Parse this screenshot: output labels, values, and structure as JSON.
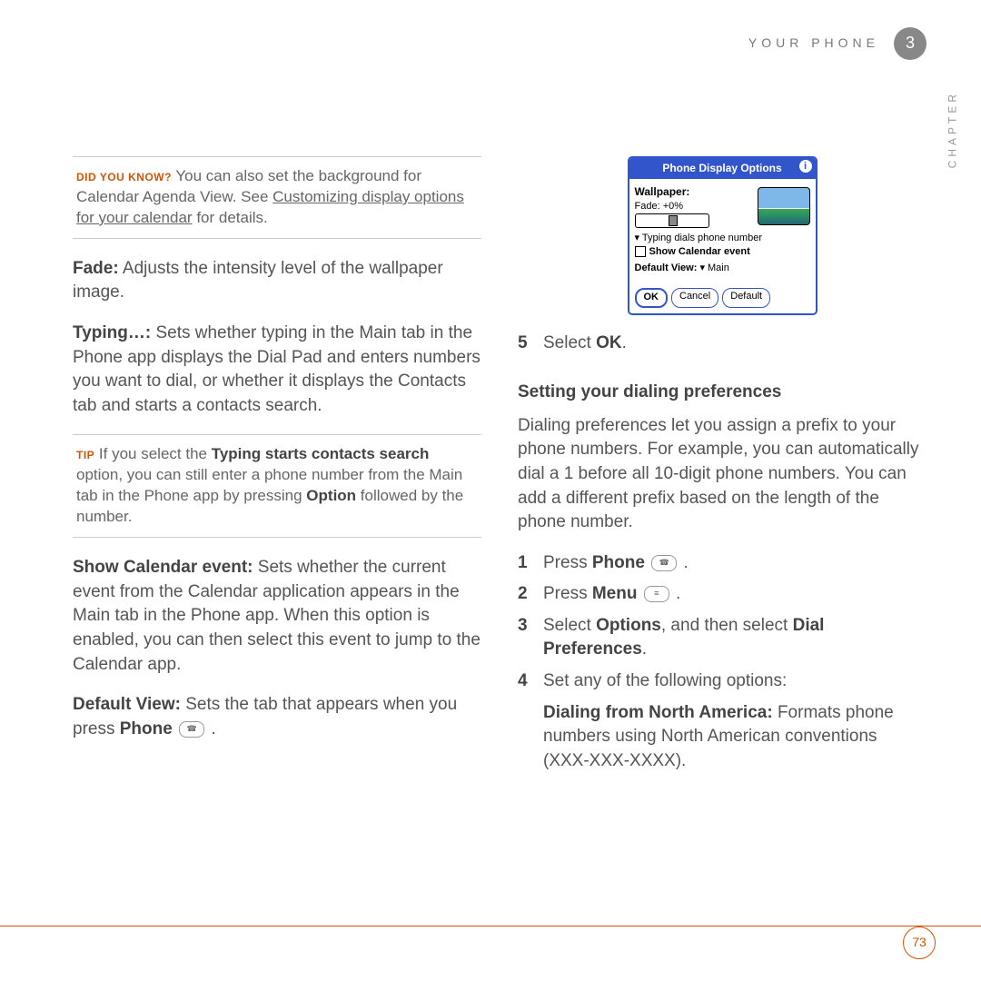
{
  "header": {
    "title": "YOUR PHONE",
    "chapter_num": "3",
    "chapter_label": "CHAPTER"
  },
  "page_number": "73",
  "left": {
    "dyk": {
      "label": "DID YOU KNOW?",
      "lead": "You can also set the background for Calendar Agenda View. See ",
      "link": "Customizing display options for your calendar",
      "trail": " for details."
    },
    "fade_term": "Fade:",
    "fade_desc": " Adjusts the intensity level of the wallpaper image.",
    "typing_term": "Typing…:",
    "typing_desc": " Sets whether typing in the Main tab in the Phone app displays the Dial Pad and enters numbers you want to dial, or whether it displays the Contacts tab and starts a contacts search.",
    "tip": {
      "label": "TIP",
      "t1": "If you select the ",
      "b1": "Typing starts contacts search",
      "t2": " option, you can still enter a phone number from the Main tab in the Phone app by pressing ",
      "b2": "Option",
      "t3": " followed by the number."
    },
    "showcal_term": "Show Calendar event:",
    "showcal_desc": " Sets whether the current event from the Calendar application appears in the Main tab in the Phone app. When this option is enabled, you can then select this event to jump to the Calendar app.",
    "defview_term": "Default View:",
    "defview_t1": " Sets the tab that appears when you press ",
    "defview_b1": "Phone",
    "defview_t2": " ."
  },
  "palm": {
    "title": "Phone Display Options",
    "wall_label": "Wallpaper:",
    "fade_label": "Fade:",
    "fade_value": "+0%",
    "drop": "Typing dials phone number",
    "check": "Show Calendar event",
    "def_label": "Default View:",
    "def_value": "Main",
    "btn_ok": "OK",
    "btn_cancel": "Cancel",
    "btn_default": "Default"
  },
  "right": {
    "step5_num": "5",
    "step5_t1": "Select ",
    "step5_b1": "OK",
    "step5_t2": ".",
    "section": "Setting your dialing preferences",
    "para": "Dialing preferences let you assign a prefix to your phone numbers. For example, you can automatically dial a 1 before all 10-digit phone numbers. You can add a different prefix based on the length of the phone number.",
    "s1_num": "1",
    "s1_t1": "Press ",
    "s1_b1": "Phone",
    "s1_t2": " .",
    "s2_num": "2",
    "s2_t1": "Press ",
    "s2_b1": "Menu",
    "s2_t2": " .",
    "s3_num": "3",
    "s3_t1": "Select ",
    "s3_b1": "Options",
    "s3_t2": ", and then select ",
    "s3_b2": "Dial Preferences",
    "s3_t3": ".",
    "s4_num": "4",
    "s4_t1": "Set any of the following options:",
    "dna_b": "Dialing from North America:",
    "dna_t": " Formats phone numbers using North American conventions (XXX-XXX-XXXX)."
  }
}
